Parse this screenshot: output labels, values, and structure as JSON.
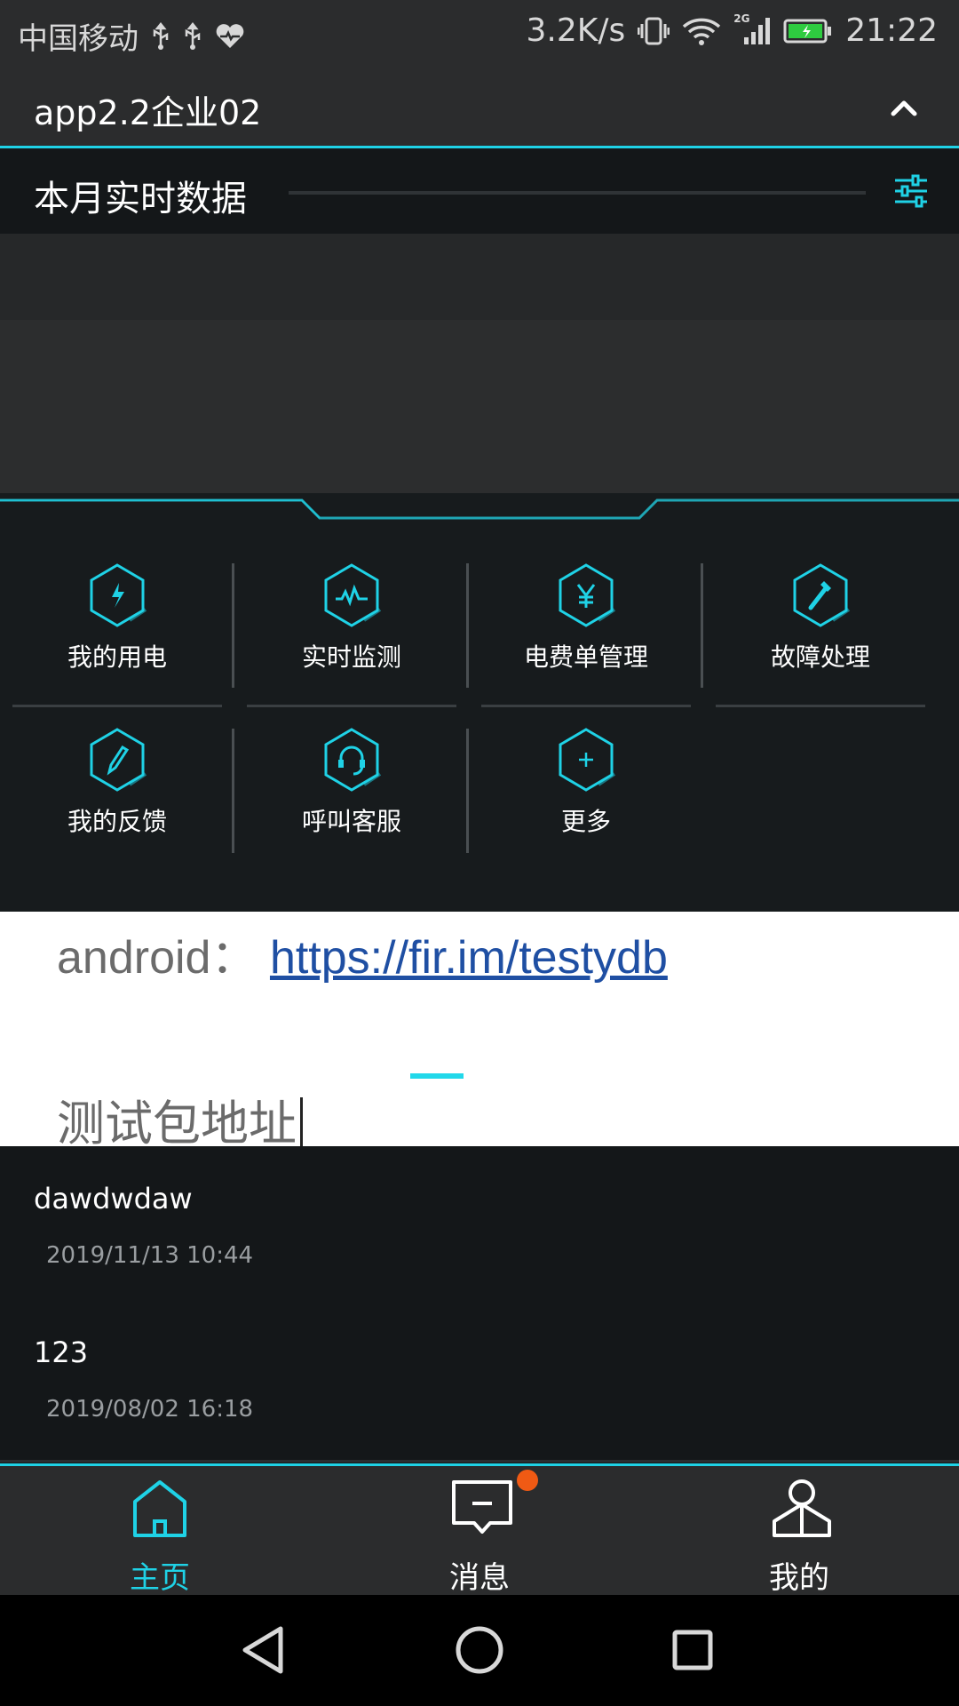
{
  "status_bar": {
    "carrier": "中国移动",
    "speed": "3.2K/s",
    "network": "2G",
    "time": "21:22"
  },
  "header": {
    "title": "app2.2企业02"
  },
  "section": {
    "title": "本月实时数据"
  },
  "grid": {
    "items": [
      {
        "label": "我的用电",
        "icon": "lightning-icon"
      },
      {
        "label": "实时监测",
        "icon": "pulse-icon"
      },
      {
        "label": "电费单管理",
        "icon": "yen-icon"
      },
      {
        "label": "故障处理",
        "icon": "wrench-icon"
      },
      {
        "label": "我的反馈",
        "icon": "pen-icon"
      },
      {
        "label": "呼叫客服",
        "icon": "headset-icon"
      },
      {
        "label": "更多",
        "icon": "plus-icon"
      }
    ]
  },
  "banner": {
    "prefix": "android：",
    "link": "https://fir.im/testydb",
    "subtitle": "测试包地址"
  },
  "messages": [
    {
      "title": "dawdwdaw",
      "time": "2019/11/13 10:44"
    },
    {
      "title": "123",
      "time": "2019/08/02 16:18"
    }
  ],
  "bottom_nav": {
    "items": [
      {
        "label": "主页",
        "icon": "home-icon",
        "active": true
      },
      {
        "label": "消息",
        "icon": "message-icon",
        "active": false
      },
      {
        "label": "我的",
        "icon": "profile-icon",
        "active": false
      }
    ]
  },
  "colors": {
    "accent": "#1fd2e6",
    "background": "#141719",
    "badge": "#f05a14"
  }
}
